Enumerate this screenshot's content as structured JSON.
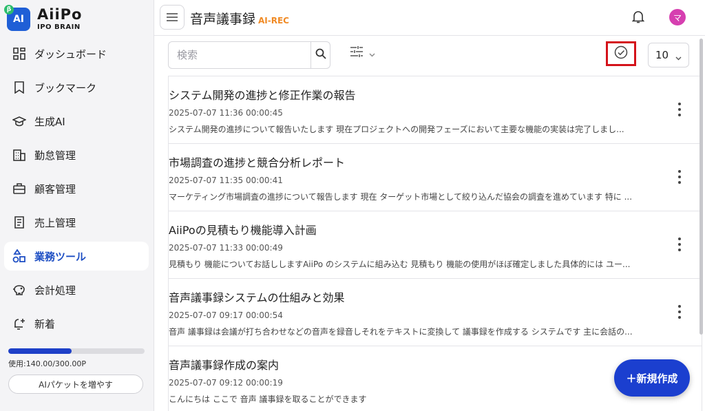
{
  "brand": {
    "name": "AiiPo",
    "sub": "IPO BRAIN",
    "badge": "AI",
    "beta": "β"
  },
  "sidebar": {
    "items": [
      {
        "label": "ダッシュボード",
        "icon": "dashboard-icon"
      },
      {
        "label": "ブックマーク",
        "icon": "bookmark-icon"
      },
      {
        "label": "生成AI",
        "icon": "graduation-cap-icon"
      },
      {
        "label": "勤怠管理",
        "icon": "building-icon"
      },
      {
        "label": "顧客管理",
        "icon": "briefcase-icon"
      },
      {
        "label": "売上管理",
        "icon": "receipt-icon"
      },
      {
        "label": "業務ツール",
        "icon": "shapes-icon",
        "active": true
      },
      {
        "label": "会計処理",
        "icon": "piggy-bank-icon"
      },
      {
        "label": "新着",
        "icon": "sparkle-bell-icon"
      }
    ],
    "usage_text": "使用:140.00/300.00P",
    "usage_fraction": 0.467,
    "buy_label": "AIパケットを増やす"
  },
  "header": {
    "title": "音声議事録",
    "tag": "AI-REC",
    "avatar": "マ"
  },
  "toolbar": {
    "search_placeholder": "検索",
    "per_page": "10"
  },
  "records": [
    {
      "title": "システム開発の進捗と修正作業の報告",
      "meta": "2025-07-07 11:36  00:00:45",
      "body": "システム開発の進捗について報告いたします 現在プロジェクトへの開発フェーズにおいて主要な機能の実装は完了しまし..."
    },
    {
      "title": "市場調査の進捗と競合分析レポート",
      "meta": "2025-07-07 11:35  00:00:41",
      "body": "マーケティング市場調査の進捗について報告します 現在 ターゲット市場として絞り込んだ協会の調査を進めています 特に ..."
    },
    {
      "title": "AiiPoの見積もり機能導入計画",
      "meta": "2025-07-07 11:33  00:00:49",
      "body": "見積もり 機能についてお話ししますAiiPo のシステムに組み込む 見積もり 機能の使用がほぼ確定しました具体的には ユー..."
    },
    {
      "title": "音声議事録システムの仕組みと効果",
      "meta": "2025-07-07 09:17  00:00:54",
      "body": "音声 議事録は会議が打ち合わせなどの音声を録音しそれをテキストに変換して 議事録を作成する システムです 主に会話の..."
    },
    {
      "title": "音声議事録作成の案内",
      "meta": "2025-07-07 09:12  00:00:19",
      "body": "こんにちは ここで 音声 議事録を取ることができます"
    }
  ],
  "fab_label": "＋新規作成"
}
